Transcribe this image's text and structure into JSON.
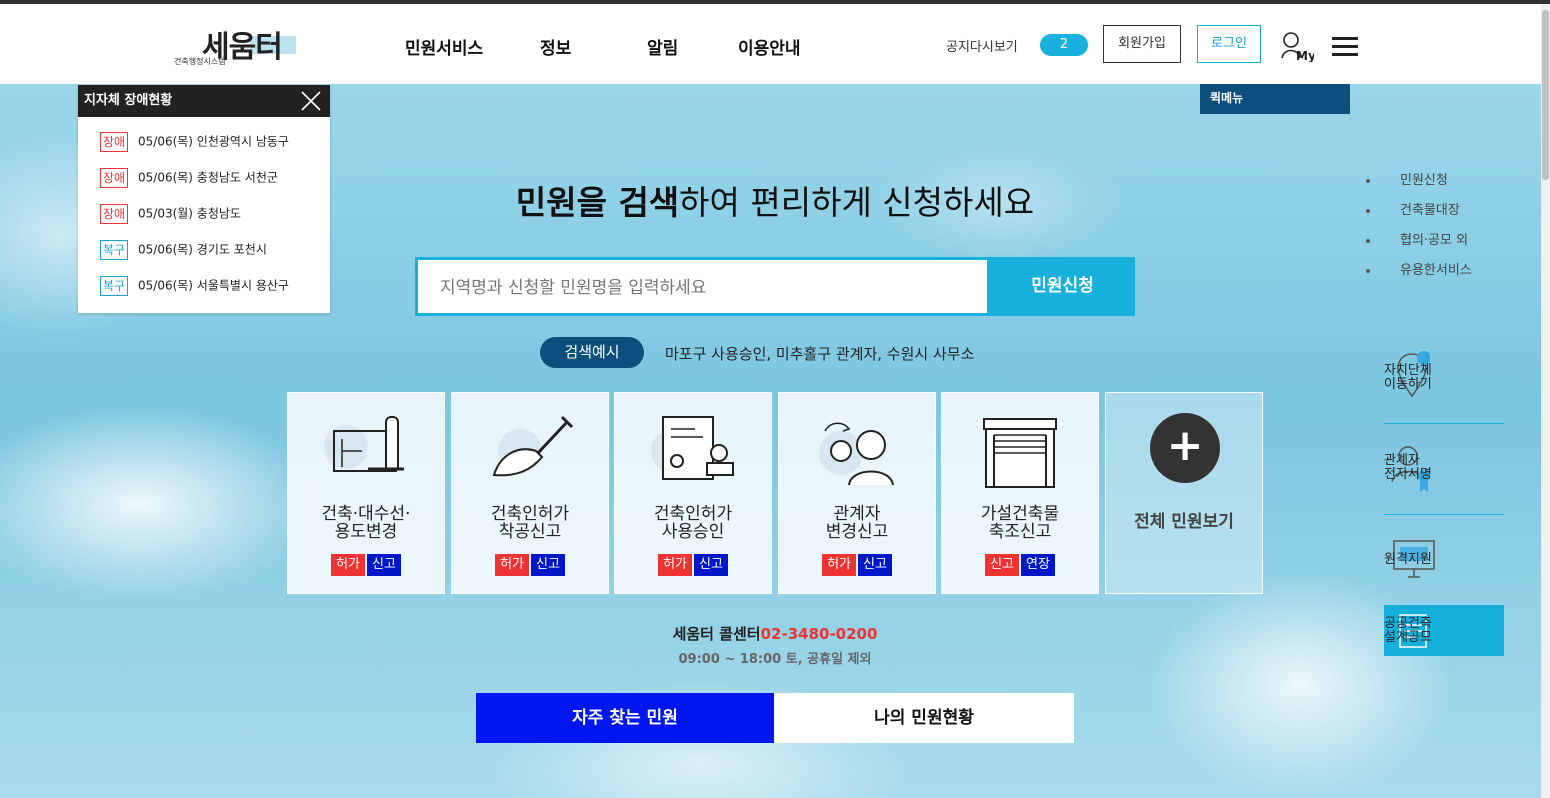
{
  "header": {
    "logo_text": "세움터",
    "logo_sub": "건축행정시스템",
    "nav": [
      "민원서비스",
      "정보",
      "알림",
      "이용안내"
    ],
    "notice_label": "공지다시보기",
    "notice_count": "2",
    "join_label": "회원가입",
    "login_label": "로그인",
    "my_label": "My"
  },
  "fault_panel": {
    "title": "지자체 장애현황",
    "items": [
      {
        "tag": "장애",
        "text": "05/06(목) 인천광역시 남동구"
      },
      {
        "tag": "장애",
        "text": "05/06(목) 충청남도 서천군"
      },
      {
        "tag": "장애",
        "text": "05/03(월) 충청남도"
      },
      {
        "tag": "복구",
        "text": "05/06(목) 경기도 포천시"
      },
      {
        "tag": "복구",
        "text": "05/06(목) 서울특별시 용산구"
      }
    ]
  },
  "quick_menu": {
    "title": "퀵메뉴",
    "links": [
      "민원신청",
      "건축물대장",
      "협의·공모 외",
      "유용한서비스"
    ],
    "side": [
      {
        "line1": "자치단체",
        "line2": "이동하기"
      },
      {
        "line1": "관계자",
        "line2": "전자서명"
      },
      {
        "line1": "원격지원",
        "line2": ""
      },
      {
        "line1": "공공건축",
        "line2": "설계공모"
      }
    ]
  },
  "hero": {
    "headline_bold": "민원을 검색",
    "headline_rest": "하여 편리하게 신청하세요",
    "search_placeholder": "지역명과 신청할 민원명을 입력하세요",
    "search_button": "민원신청",
    "example_label": "검색예시",
    "example_text": "마포구 사용승인, 미추홀구 관계자, 수원시 사무소"
  },
  "cards": [
    {
      "line1": "건축·대수선·",
      "line2": "용도변경",
      "chips": [
        "허가",
        "신고"
      ]
    },
    {
      "line1": "건축인허가",
      "line2": "착공신고",
      "chips": [
        "허가",
        "신고"
      ]
    },
    {
      "line1": "건축인허가",
      "line2": "사용승인",
      "chips": [
        "허가",
        "신고"
      ]
    },
    {
      "line1": "관계자",
      "line2": "변경신고",
      "chips": [
        "허가",
        "신고"
      ]
    },
    {
      "line1": "가설건축물",
      "line2": "축조신고",
      "chips": [
        "신고",
        "연장"
      ]
    }
  ],
  "all_card": {
    "plus": "+",
    "label": "전체 민원보기"
  },
  "callcenter": {
    "label": "세움터 콜센터",
    "number": "02-3480-0200",
    "hours": "09:00 ~ 18:00 토, 공휴일 제외"
  },
  "tabs": {
    "frequent": "자주 찾는 민원",
    "mine": "나의 민원현황"
  },
  "colors": {
    "accent": "#17b0dc",
    "navy": "#0d4f7c",
    "danger": "#e33333",
    "blue": "#0016f0"
  }
}
